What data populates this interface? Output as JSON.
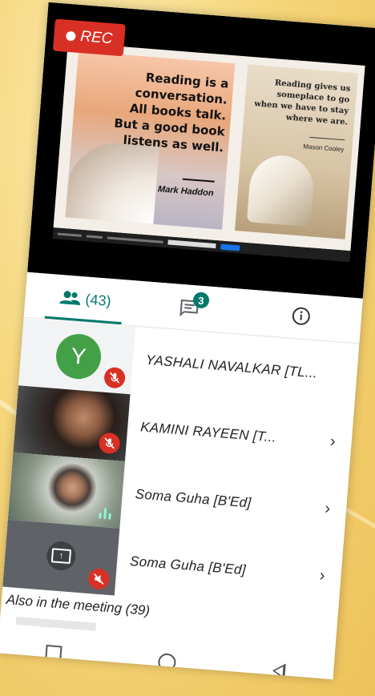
{
  "recording": {
    "label": "REC"
  },
  "slide": {
    "quote1": "Reading is a conversation. All books talk. But a good book listens as well.",
    "quote1_author": "Mark Haddon",
    "quote2": "Reading gives us someplace to go when we have to stay where we are.",
    "quote2_author": "Mason Cooley"
  },
  "tabs": {
    "people_count": "(43)",
    "chat_badge": "3"
  },
  "participants": [
    {
      "name": "YASHALI NAVALKAR [TL...",
      "avatar_letter": "Y",
      "muted": true
    },
    {
      "name": "KAMINI RAYEEN [T...",
      "muted": true
    },
    {
      "name": "Soma Guha [B'Ed]",
      "muted": false
    },
    {
      "name": "Soma Guha [B'Ed]",
      "muted": true,
      "presenting": true
    }
  ],
  "also_in_meeting": "Also in the meeting (39)",
  "chevron": "›",
  "colors": {
    "accent": "#00796b",
    "rec": "#d93025",
    "avatar_green": "#43a047"
  },
  "icons": [
    "people-icon",
    "chat-icon",
    "info-icon",
    "mic-off-icon",
    "present-screen-icon",
    "audio-level-icon",
    "chevron-right-icon"
  ]
}
